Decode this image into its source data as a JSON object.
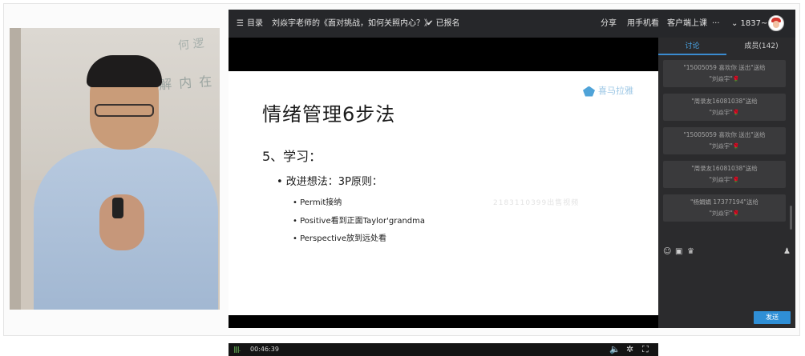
{
  "player": {
    "menu_label": "目录",
    "course_title": "刘焱宇老师的《面对挑战，如何关照内心？》",
    "registered_label": "✔ 已报名",
    "share_label": "分享",
    "mobile_label": "用手机看",
    "client_label": "客户端上课",
    "more_label": "···",
    "user_label": "⌄ 1837~"
  },
  "slide": {
    "logo_text": "喜马拉雅",
    "title": "情绪管理6步法",
    "step": "5、学习：",
    "bullet": "• 改进想法：3P原则：",
    "subpoints": [
      "• Permit接纳",
      "• Positive看到正面Taylor'grandma",
      "• Perspective放到远处看"
    ],
    "watermark": "2183110399出售视频"
  },
  "controls": {
    "signal": "||||.",
    "time": "00:46:39"
  },
  "chat": {
    "tab_discussion": "讨论",
    "tab_members": "成员(142)",
    "messages": [
      {
        "from": "\"15005059 喜欢你 送出\"送给",
        "to": "\"刘焱宇\""
      },
      {
        "from": "\"周录友16081038\"送给",
        "to": "\"刘焱宇\""
      },
      {
        "from": "\"15005059 喜欢你 送出\"送给",
        "to": "\"刘焱宇\""
      },
      {
        "from": "\"周录友16081038\"送给",
        "to": "\"刘焱宇\""
      },
      {
        "from": "\"杨娟娟 17377194\"送给",
        "to": "\"刘焱宇\""
      }
    ],
    "send_label": "发送"
  },
  "colors": {
    "accent": "#2f8fd6",
    "tab_active": "#4aa6e8",
    "topbar": "#26272a",
    "chat_bg": "#2b2b2d"
  }
}
